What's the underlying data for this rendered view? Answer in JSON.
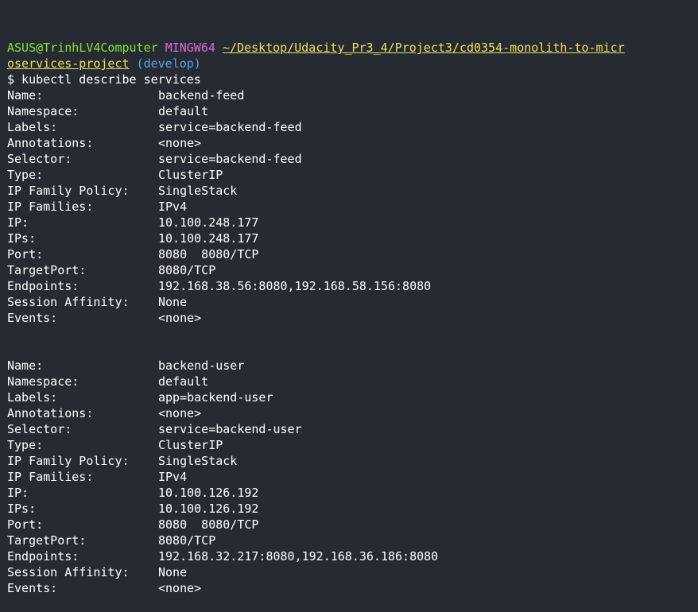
{
  "prompt": {
    "user_host": "ASUS@TrinhLV4Computer",
    "shell": "MINGW64",
    "path_part1": "~/Desktop/Udacity_Pr3_4/Project3/cd0354-monolith-to-micr",
    "path_part2": "oservices-project",
    "branch": "(develop)"
  },
  "command": "$ kubectl describe services",
  "services": [
    {
      "fields": [
        {
          "key": "Name:",
          "value": "backend-feed"
        },
        {
          "key": "Namespace:",
          "value": "default"
        },
        {
          "key": "Labels:",
          "value": "service=backend-feed"
        },
        {
          "key": "Annotations:",
          "value": "<none>"
        },
        {
          "key": "Selector:",
          "value": "service=backend-feed"
        },
        {
          "key": "Type:",
          "value": "ClusterIP"
        },
        {
          "key": "IP Family Policy:",
          "value": "SingleStack"
        },
        {
          "key": "IP Families:",
          "value": "IPv4"
        },
        {
          "key": "IP:",
          "value": "10.100.248.177"
        },
        {
          "key": "IPs:",
          "value": "10.100.248.177"
        },
        {
          "key": "Port:",
          "value": "8080  8080/TCP"
        },
        {
          "key": "TargetPort:",
          "value": "8080/TCP"
        },
        {
          "key": "Endpoints:",
          "value": "192.168.38.56:8080,192.168.58.156:8080"
        },
        {
          "key": "Session Affinity:",
          "value": "None"
        },
        {
          "key": "Events:",
          "value": "<none>"
        }
      ]
    },
    {
      "fields": [
        {
          "key": "Name:",
          "value": "backend-user"
        },
        {
          "key": "Namespace:",
          "value": "default"
        },
        {
          "key": "Labels:",
          "value": "app=backend-user"
        },
        {
          "key": "Annotations:",
          "value": "<none>"
        },
        {
          "key": "Selector:",
          "value": "service=backend-user"
        },
        {
          "key": "Type:",
          "value": "ClusterIP"
        },
        {
          "key": "IP Family Policy:",
          "value": "SingleStack"
        },
        {
          "key": "IP Families:",
          "value": "IPv4"
        },
        {
          "key": "IP:",
          "value": "10.100.126.192"
        },
        {
          "key": "IPs:",
          "value": "10.100.126.192"
        },
        {
          "key": "Port:",
          "value": "8080  8080/TCP"
        },
        {
          "key": "TargetPort:",
          "value": "8080/TCP"
        },
        {
          "key": "Endpoints:",
          "value": "192.168.32.217:8080,192.168.36.186:8080"
        },
        {
          "key": "Session Affinity:",
          "value": "None"
        },
        {
          "key": "Events:",
          "value": "<none>"
        }
      ]
    }
  ]
}
